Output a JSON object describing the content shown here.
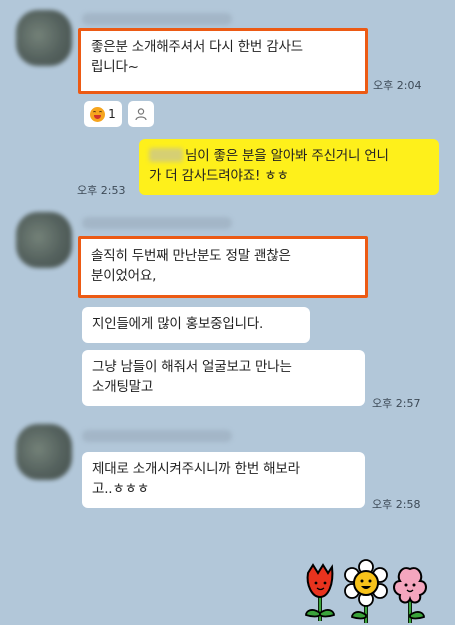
{
  "messages": [
    {
      "text_line1": "좋은분 소개해주셔서 다시 한번 감사드",
      "text_line2": "립니다~",
      "time": "오후 2:04"
    },
    {
      "text_line1": "님이 좋은 분을 알아봐 주신거니 언니",
      "text_line2": "가 더 감사드려야죠! ㅎㅎ",
      "time": "오후 2:53"
    },
    {
      "text_line1": "솔직히 두번째 만난분도 정말 괜찮은",
      "text_line2": "분이었어요,"
    },
    {
      "text": "지인들에게 많이 홍보중입니다."
    },
    {
      "text_line1": "그냥 남들이 해줘서 얼굴보고 만나는",
      "text_line2": "소개팅말고",
      "time": "오후 2:57"
    },
    {
      "text_line1": "제대로 소개시켜주시니까 한번 해보라",
      "text_line2": "고..ㅎㅎㅎ",
      "time": "오후 2:58"
    }
  ],
  "reaction": {
    "count": "1",
    "emoji_icon": "laughing-face-icon",
    "add_icon": "person-icon"
  },
  "colors": {
    "background": "#b2c7d9",
    "my_bubble": "#fef01b",
    "highlight": "#ec5a14"
  }
}
